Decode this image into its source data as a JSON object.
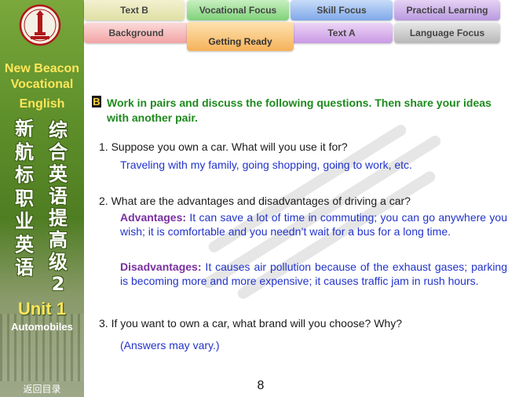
{
  "sidebar": {
    "series_title_lines": [
      "New Beacon",
      "Vocational",
      "English"
    ],
    "cn_title_left": [
      "新",
      "航",
      "标",
      "职",
      "业",
      "英",
      "语"
    ],
    "cn_title_right": [
      "综",
      "合",
      "英",
      "语",
      "提",
      "高",
      "级",
      "2"
    ],
    "unit_title": "Unit 1",
    "unit_subtitle": "Automobiles",
    "back_link": "返回目录",
    "colors": {
      "accent_yellow": "#ffe65a",
      "panel_green": "#5e8f2a"
    }
  },
  "tabs": {
    "text_b": "Text B",
    "vocational_focus": "Vocational Focus",
    "skill_focus": "Skill Focus",
    "practical_learning": "Practical Learning",
    "background": "Background",
    "getting_ready": "Getting Ready",
    "text_a": "Text A",
    "language_focus": "Language Focus",
    "active": "Getting Ready"
  },
  "main": {
    "section_letter": "B",
    "instruction": "Work in pairs and discuss the following questions. Then share your ideas with another pair.",
    "q1": "1. Suppose you own a car. What will you use it for?",
    "a1": "Traveling with my family, going shopping, going to work, etc.",
    "q2": "2. What are the advantages and disadvantages of driving a car?",
    "a2_adv_label": "Advantages:",
    "a2_adv_text": " It can save a lot of time in commuting; you can go anywhere you wish; it is comfortable and you needn’t wait for a bus for a long time.",
    "a2_dis_label": "Disadvantages:",
    "a2_dis_text": " It causes air pollution because of the exhaust gases; parking is becoming more and more expensive; it causes traffic jam in rush hours.",
    "q3": "3. If you want to own a car, what brand will you choose? Why?",
    "a3": "(Answers may vary.)",
    "page_number": "8",
    "colors": {
      "instruction_green": "#1d8a1d",
      "answer_blue": "#2233cc",
      "label_purple": "#7a2fa0"
    }
  }
}
